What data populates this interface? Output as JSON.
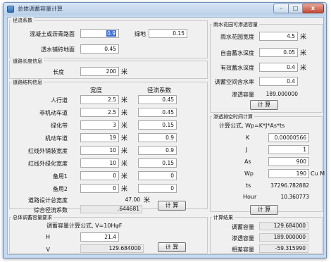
{
  "window": {
    "title": "总体调蓄容量计算",
    "close_glyph": "x",
    "min_glyph": "–",
    "max_glyph": "□"
  },
  "runoff": {
    "title": "径流系数",
    "concrete_label": "混凝土或沥青路面",
    "concrete_value": "0.9",
    "green_label": "绿地",
    "green_value": "0.15",
    "paver_label": "透水铺砖地面",
    "paver_value": "0.45"
  },
  "road_length": {
    "title": "道路长度信息",
    "label": "长度",
    "value": "200",
    "unit": "米"
  },
  "road_struct": {
    "title": "道路结构信息",
    "col_width": "宽度",
    "col_coef": "径流系数",
    "rows": [
      {
        "label": "人行道",
        "width": "2.5",
        "unit": "米",
        "coef": "0.45"
      },
      {
        "label": "非机动车道",
        "width": "2.5",
        "unit": "米",
        "coef": "0.45"
      },
      {
        "label": "绿化带",
        "width": "3",
        "unit": "米",
        "coef": "0.15"
      },
      {
        "label": "机动车道",
        "width": "19",
        "unit": "米",
        "coef": "0.9"
      },
      {
        "label": "红线外铺装宽度",
        "width": "10",
        "unit": "米",
        "coef": "0.9"
      },
      {
        "label": "红线外绿化宽度",
        "width": "10",
        "unit": "米",
        "coef": "0.15"
      },
      {
        "label": "备用1",
        "width": "0",
        "unit": "米",
        "coef": "0"
      },
      {
        "label": "备用2",
        "width": "0",
        "unit": "米",
        "coef": "0"
      }
    ],
    "total_width_label": "道路设计总宽度",
    "total_width_value": "47.00",
    "total_width_unit": "米",
    "combined_coef_label": "综合径流系数",
    "combined_coef_value": ".644681",
    "calc_button": "计 算"
  },
  "overall": {
    "title": "总体调蓄容量要求",
    "formula_label": "调蓄容量计算公式, V=10HψF",
    "h_label": "H",
    "h_value": "21.4",
    "v_label": "V",
    "v_value": "129.684000",
    "calc_button": "计 算"
  },
  "rain_garden": {
    "title": "雨水花园可渗透容量",
    "width_label": "雨水花园宽度",
    "width_value": "4.5",
    "width_unit": "米",
    "storage_depth_label": "自由蓄水深度",
    "storage_depth_value": "0.05",
    "storage_depth_unit": "米",
    "eff_depth_label": "有效蓄水深度",
    "eff_depth_value": "0.4",
    "eff_depth_unit": "米",
    "void_label": "调蓄空间含水率",
    "void_value": "0.4",
    "infil_label": "渗透容量",
    "infil_value": "189.000000",
    "calc_button": "计 算"
  },
  "infiltration_time": {
    "title": "渗透排空时间计算",
    "formula_label": "计算公式, Wp=K*J*As*ts",
    "k_label": "K",
    "k_value": "0.00000566",
    "j_label": "J",
    "j_value": "1",
    "as_label": "As",
    "as_value": "900",
    "wp_label": "Wp",
    "wp_value": "190",
    "wp_unit": "Cu M",
    "ts_label": "ts",
    "ts_value": "37296.782882",
    "hour_label": "Hour",
    "hour_value": "10.360773",
    "calc_button": "计 算"
  },
  "result": {
    "title": "计算结果",
    "storage_label": "调蓄容量",
    "storage_value": "129.684000",
    "infil_label": "渗透容量",
    "infil_value": "189.000000",
    "diff_label": "相差容量",
    "diff_value": "-59.315990"
  }
}
